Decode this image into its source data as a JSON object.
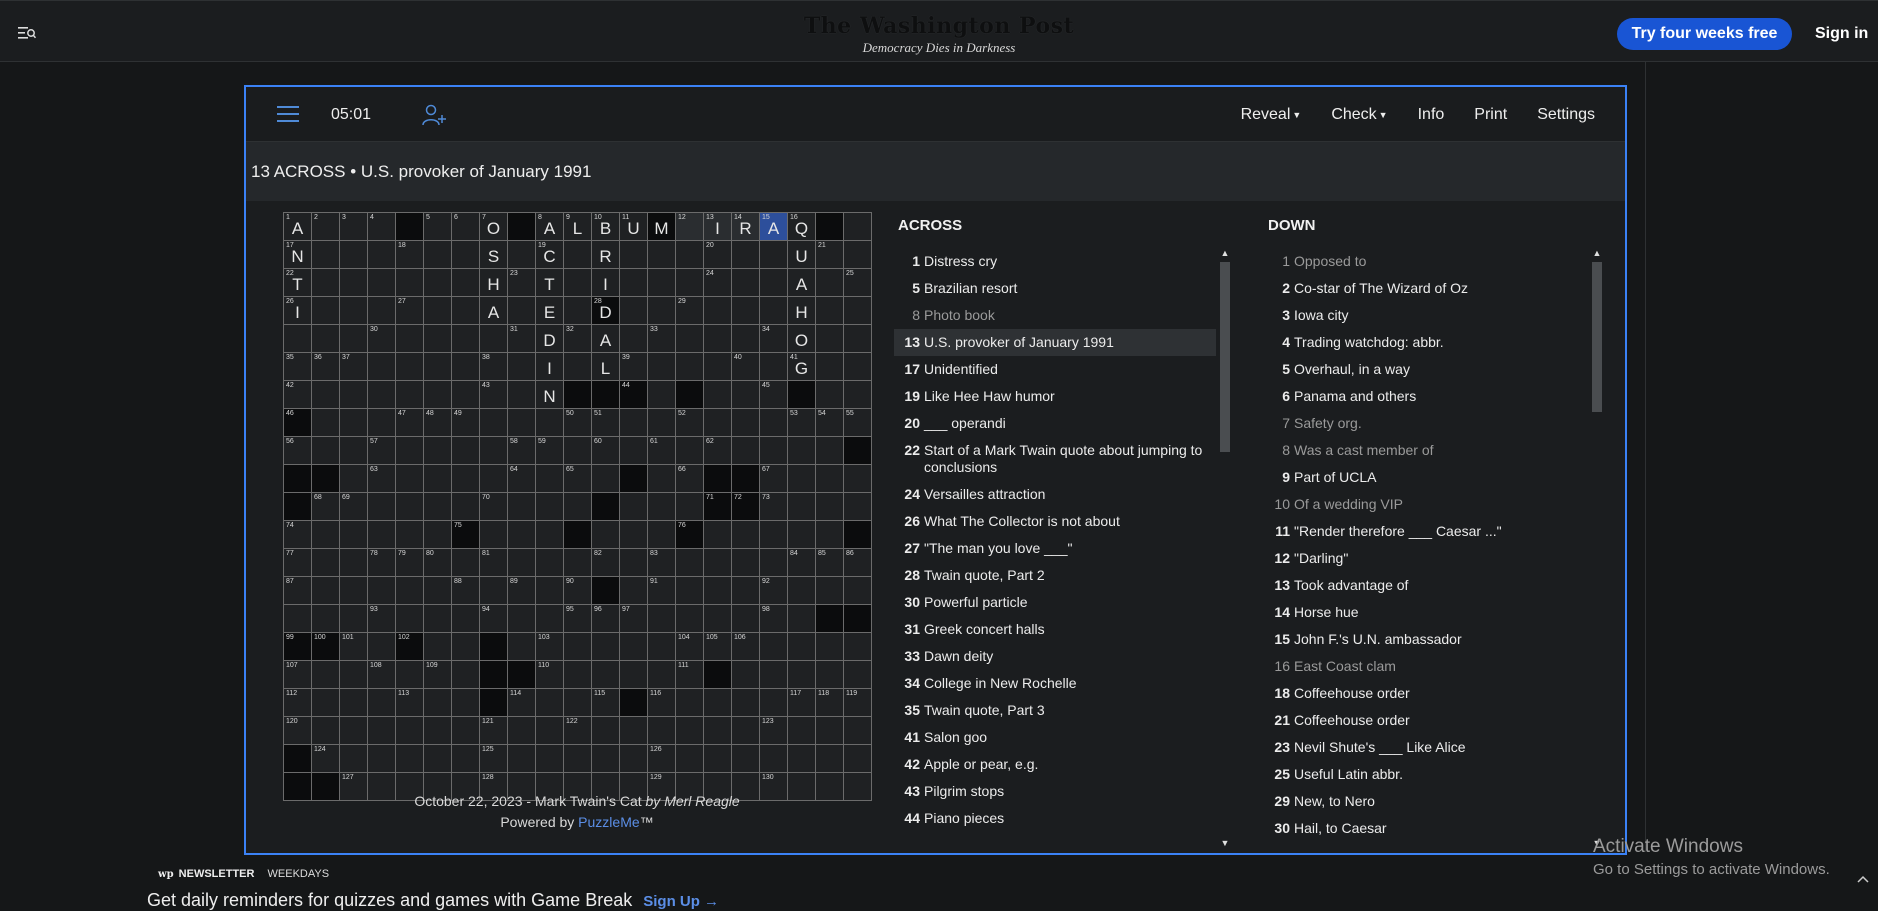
{
  "header": {
    "brand": "The Washington Post",
    "tagline": "Democracy Dies in Darkness",
    "cta": "Try four weeks free",
    "signin": "Sign in",
    "icons": {
      "menu": "menu-search-icon"
    }
  },
  "toolbar": {
    "timer": "05:01",
    "menu_items": [
      {
        "label": "Reveal",
        "dropdown": true
      },
      {
        "label": "Check",
        "dropdown": true
      },
      {
        "label": "Info",
        "dropdown": false
      },
      {
        "label": "Print",
        "dropdown": false
      },
      {
        "label": "Settings",
        "dropdown": false
      }
    ],
    "icons": {
      "menu": "hamburger-icon",
      "invite": "add-user-icon"
    }
  },
  "current_clue": "13 ACROSS • U.S. provoker of January 1991",
  "grid": {
    "size": 21,
    "active_cell": [
      0,
      17
    ],
    "active_word": {
      "row": 0,
      "cols": [
        14,
        15,
        16,
        17
      ]
    },
    "black_cells": [
      [
        0,
        4
      ],
      [
        0,
        8
      ],
      [
        0,
        13
      ],
      [
        0,
        19
      ],
      [
        3,
        11
      ],
      [
        6,
        10
      ],
      [
        6,
        11
      ],
      [
        6,
        12
      ],
      [
        6,
        14
      ],
      [
        6,
        18
      ],
      [
        7,
        0
      ],
      [
        8,
        20
      ],
      [
        9,
        0
      ],
      [
        9,
        1
      ],
      [
        9,
        12
      ],
      [
        9,
        15
      ],
      [
        9,
        16
      ],
      [
        10,
        0
      ],
      [
        10,
        11
      ],
      [
        10,
        15
      ],
      [
        10,
        16
      ],
      [
        11,
        6
      ],
      [
        11,
        10
      ],
      [
        11,
        14
      ],
      [
        11,
        20
      ],
      [
        13,
        11
      ],
      [
        14,
        19
      ],
      [
        14,
        20
      ],
      [
        15,
        0
      ],
      [
        15,
        1
      ],
      [
        15,
        4
      ],
      [
        15,
        7
      ],
      [
        16,
        7
      ],
      [
        16,
        8
      ],
      [
        16,
        15
      ],
      [
        17,
        7
      ],
      [
        17,
        12
      ],
      [
        19,
        0
      ],
      [
        20,
        0
      ],
      [
        20,
        1
      ]
    ],
    "numbers": [
      [
        0,
        0,
        "1"
      ],
      [
        0,
        1,
        "2"
      ],
      [
        0,
        2,
        "3"
      ],
      [
        0,
        3,
        "4"
      ],
      [
        0,
        5,
        "5"
      ],
      [
        0,
        6,
        "6"
      ],
      [
        0,
        7,
        "7"
      ],
      [
        0,
        9,
        "8"
      ],
      [
        0,
        10,
        "9"
      ],
      [
        0,
        11,
        "10"
      ],
      [
        0,
        12,
        "11"
      ],
      [
        0,
        14,
        "12"
      ],
      [
        0,
        15,
        "13"
      ],
      [
        0,
        16,
        "14"
      ],
      [
        0,
        17,
        "15"
      ],
      [
        0,
        18,
        "16"
      ],
      [
        1,
        0,
        "17"
      ],
      [
        1,
        4,
        "18"
      ],
      [
        1,
        9,
        "19"
      ],
      [
        1,
        15,
        "20"
      ],
      [
        1,
        19,
        "21"
      ],
      [
        2,
        0,
        "22"
      ],
      [
        2,
        8,
        "23"
      ],
      [
        2,
        15,
        "24"
      ],
      [
        2,
        20,
        "25"
      ],
      [
        3,
        0,
        "26"
      ],
      [
        3,
        4,
        "27"
      ],
      [
        3,
        11,
        "28"
      ],
      [
        3,
        14,
        "29"
      ],
      [
        4,
        3,
        "30"
      ],
      [
        4,
        8,
        "31"
      ],
      [
        4,
        10,
        "32"
      ],
      [
        4,
        13,
        "33"
      ],
      [
        4,
        17,
        "34"
      ],
      [
        5,
        0,
        "35"
      ],
      [
        5,
        1,
        "36"
      ],
      [
        5,
        2,
        "37"
      ],
      [
        5,
        7,
        "38"
      ],
      [
        5,
        12,
        "39"
      ],
      [
        5,
        16,
        "40"
      ],
      [
        5,
        18,
        "41"
      ],
      [
        6,
        0,
        "42"
      ],
      [
        6,
        7,
        "43"
      ],
      [
        6,
        12,
        "44"
      ],
      [
        6,
        17,
        "45"
      ],
      [
        7,
        0,
        "46"
      ],
      [
        7,
        4,
        "47"
      ],
      [
        7,
        5,
        "48"
      ],
      [
        7,
        6,
        "49"
      ],
      [
        7,
        10,
        "50"
      ],
      [
        7,
        11,
        "51"
      ],
      [
        7,
        14,
        "52"
      ],
      [
        7,
        18,
        "53"
      ],
      [
        7,
        19,
        "54"
      ],
      [
        7,
        20,
        "55"
      ],
      [
        8,
        0,
        "56"
      ],
      [
        8,
        3,
        "57"
      ],
      [
        8,
        8,
        "58"
      ],
      [
        8,
        9,
        "59"
      ],
      [
        8,
        11,
        "60"
      ],
      [
        8,
        13,
        "61"
      ],
      [
        8,
        15,
        "62"
      ],
      [
        9,
        3,
        "63"
      ],
      [
        9,
        8,
        "64"
      ],
      [
        9,
        10,
        "65"
      ],
      [
        9,
        14,
        "66"
      ],
      [
        9,
        17,
        "67"
      ],
      [
        10,
        1,
        "68"
      ],
      [
        10,
        2,
        "69"
      ],
      [
        10,
        7,
        "70"
      ],
      [
        10,
        15,
        "71"
      ],
      [
        10,
        16,
        "72"
      ],
      [
        10,
        17,
        "73"
      ],
      [
        11,
        0,
        "74"
      ],
      [
        11,
        6,
        "75"
      ],
      [
        11,
        14,
        "76"
      ],
      [
        12,
        0,
        "77"
      ],
      [
        12,
        3,
        "78"
      ],
      [
        12,
        4,
        "79"
      ],
      [
        12,
        5,
        "80"
      ],
      [
        12,
        7,
        "81"
      ],
      [
        12,
        11,
        "82"
      ],
      [
        12,
        13,
        "83"
      ],
      [
        12,
        18,
        "84"
      ],
      [
        12,
        19,
        "85"
      ],
      [
        12,
        20,
        "86"
      ],
      [
        13,
        0,
        "87"
      ],
      [
        13,
        6,
        "88"
      ],
      [
        13,
        8,
        "89"
      ],
      [
        13,
        10,
        "90"
      ],
      [
        13,
        13,
        "91"
      ],
      [
        13,
        17,
        "92"
      ],
      [
        14,
        3,
        "93"
      ],
      [
        14,
        7,
        "94"
      ],
      [
        14,
        10,
        "95"
      ],
      [
        14,
        11,
        "96"
      ],
      [
        14,
        12,
        "97"
      ],
      [
        14,
        17,
        "98"
      ],
      [
        15,
        0,
        "99"
      ],
      [
        15,
        1,
        "100"
      ],
      [
        15,
        2,
        "101"
      ],
      [
        15,
        4,
        "102"
      ],
      [
        15,
        9,
        "103"
      ],
      [
        15,
        14,
        "104"
      ],
      [
        15,
        15,
        "105"
      ],
      [
        15,
        16,
        "106"
      ],
      [
        16,
        0,
        "107"
      ],
      [
        16,
        3,
        "108"
      ],
      [
        16,
        5,
        "109"
      ],
      [
        16,
        9,
        "110"
      ],
      [
        16,
        14,
        "111"
      ],
      [
        17,
        0,
        "112"
      ],
      [
        17,
        4,
        "113"
      ],
      [
        17,
        8,
        "114"
      ],
      [
        17,
        11,
        "115"
      ],
      [
        17,
        13,
        "116"
      ],
      [
        17,
        18,
        "117"
      ],
      [
        17,
        19,
        "118"
      ],
      [
        17,
        20,
        "119"
      ],
      [
        18,
        0,
        "120"
      ],
      [
        18,
        7,
        "121"
      ],
      [
        18,
        10,
        "122"
      ],
      [
        18,
        17,
        "123"
      ],
      [
        19,
        1,
        "124"
      ],
      [
        19,
        7,
        "125"
      ],
      [
        19,
        13,
        "126"
      ],
      [
        20,
        2,
        "127"
      ],
      [
        20,
        7,
        "128"
      ],
      [
        20,
        13,
        "129"
      ],
      [
        20,
        17,
        "130"
      ]
    ],
    "letters": [
      [
        0,
        0,
        "A"
      ],
      [
        0,
        7,
        "O"
      ],
      [
        0,
        9,
        "A"
      ],
      [
        0,
        10,
        "L"
      ],
      [
        0,
        11,
        "B"
      ],
      [
        0,
        12,
        "U"
      ],
      [
        0,
        13,
        "M"
      ],
      [
        0,
        15,
        "I"
      ],
      [
        0,
        16,
        "R"
      ],
      [
        0,
        17,
        "A"
      ],
      [
        0,
        18,
        "Q"
      ],
      [
        1,
        0,
        "N"
      ],
      [
        1,
        7,
        "S"
      ],
      [
        1,
        9,
        "C"
      ],
      [
        1,
        11,
        "R"
      ],
      [
        1,
        18,
        "U"
      ],
      [
        2,
        0,
        "T"
      ],
      [
        2,
        7,
        "H"
      ],
      [
        2,
        9,
        "T"
      ],
      [
        2,
        11,
        "I"
      ],
      [
        2,
        18,
        "A"
      ],
      [
        3,
        0,
        "I"
      ],
      [
        3,
        7,
        "A"
      ],
      [
        3,
        9,
        "E"
      ],
      [
        3,
        11,
        "D"
      ],
      [
        3,
        18,
        "H"
      ],
      [
        4,
        9,
        "D"
      ],
      [
        4,
        11,
        "A"
      ],
      [
        4,
        18,
        "O"
      ],
      [
        5,
        9,
        "I"
      ],
      [
        5,
        11,
        "L"
      ],
      [
        5,
        18,
        "G"
      ],
      [
        6,
        9,
        "N"
      ]
    ]
  },
  "puzzle_info": {
    "date_title": "October 22, 2023 - Mark Twain's Cat",
    "author": "by Merl Reagle",
    "powered_prefix": "Powered by",
    "powered_link": "PuzzleMe",
    "powered_suffix": "™"
  },
  "across": {
    "heading": "ACROSS",
    "clues": [
      {
        "num": "1",
        "text": "Distress cry",
        "state": ""
      },
      {
        "num": "5",
        "text": "Brazilian resort",
        "state": ""
      },
      {
        "num": "8",
        "text": "Photo book",
        "state": "done"
      },
      {
        "num": "13",
        "text": "U.S. provoker of January 1991",
        "state": "sel"
      },
      {
        "num": "17",
        "text": "Unidentified",
        "state": ""
      },
      {
        "num": "19",
        "text": "Like Hee Haw humor",
        "state": ""
      },
      {
        "num": "20",
        "text": "___ operandi",
        "state": ""
      },
      {
        "num": "22",
        "text": "Start of a Mark Twain quote about jumping to conclusions",
        "state": ""
      },
      {
        "num": "24",
        "text": "Versailles attraction",
        "state": ""
      },
      {
        "num": "26",
        "text": "What The Collector is not about",
        "state": ""
      },
      {
        "num": "27",
        "text": "\"The man you love ___\"",
        "state": ""
      },
      {
        "num": "28",
        "text": "Twain quote, Part 2",
        "state": ""
      },
      {
        "num": "30",
        "text": "Powerful particle",
        "state": ""
      },
      {
        "num": "31",
        "text": "Greek concert halls",
        "state": ""
      },
      {
        "num": "33",
        "text": "Dawn deity",
        "state": ""
      },
      {
        "num": "34",
        "text": "College in New Rochelle",
        "state": ""
      },
      {
        "num": "35",
        "text": "Twain quote, Part 3",
        "state": ""
      },
      {
        "num": "41",
        "text": "Salon goo",
        "state": ""
      },
      {
        "num": "42",
        "text": "Apple or pear, e.g.",
        "state": ""
      },
      {
        "num": "43",
        "text": "Pilgrim stops",
        "state": ""
      },
      {
        "num": "44",
        "text": "Piano pieces",
        "state": ""
      }
    ]
  },
  "down": {
    "heading": "DOWN",
    "clues": [
      {
        "num": "1",
        "text": "Opposed to",
        "state": "done"
      },
      {
        "num": "2",
        "text": "Co-star of The Wizard of Oz",
        "state": ""
      },
      {
        "num": "3",
        "text": "Iowa city",
        "state": ""
      },
      {
        "num": "4",
        "text": "Trading watchdog: abbr.",
        "state": ""
      },
      {
        "num": "5",
        "text": "Overhaul, in a way",
        "state": ""
      },
      {
        "num": "6",
        "text": "Panama and others",
        "state": ""
      },
      {
        "num": "7",
        "text": "Safety org.",
        "state": "done"
      },
      {
        "num": "8",
        "text": "Was a cast member of",
        "state": "done"
      },
      {
        "num": "9",
        "text": "Part of UCLA",
        "state": ""
      },
      {
        "num": "10",
        "text": "Of a wedding VIP",
        "state": "done"
      },
      {
        "num": "11",
        "text": "\"Render therefore ___ Caesar ...\"",
        "state": ""
      },
      {
        "num": "12",
        "text": "\"Darling\"",
        "state": ""
      },
      {
        "num": "13",
        "text": "Took advantage of",
        "state": ""
      },
      {
        "num": "14",
        "text": "Horse hue",
        "state": ""
      },
      {
        "num": "15",
        "text": "John F.'s U.N. ambassador",
        "state": "cross"
      },
      {
        "num": "16",
        "text": "East Coast clam",
        "state": "done"
      },
      {
        "num": "18",
        "text": "Coffeehouse order",
        "state": ""
      },
      {
        "num": "21",
        "text": "Coffeehouse order",
        "state": ""
      },
      {
        "num": "23",
        "text": "Nevil Shute's ___ Like Alice",
        "state": ""
      },
      {
        "num": "25",
        "text": "Useful Latin abbr.",
        "state": ""
      },
      {
        "num": "29",
        "text": "New, to Nero",
        "state": ""
      },
      {
        "num": "30",
        "text": "Hail, to Caesar",
        "state": ""
      }
    ]
  },
  "newsletter": {
    "brand_mark": "wp",
    "label": "NEWSLETTER",
    "frequency": "WEEKDAYS",
    "promo": "Get daily reminders for quizzes and games with Game Break",
    "signup": "Sign Up →"
  },
  "watermark": {
    "title": "Activate Windows",
    "subtitle": "Go to Settings to activate Windows."
  },
  "colors": {
    "accent": "#3b82f6",
    "cta": "#1955d4",
    "active_cell": "#2d4f9b",
    "background": "#151718"
  }
}
